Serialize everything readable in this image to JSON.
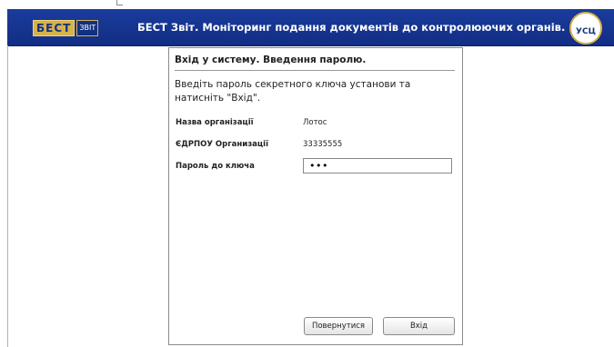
{
  "header": {
    "logo_blocks": [
      "БЕСТ"
    ],
    "logo_zvit": "ЗВІТ",
    "title": "БЕСТ Звіт. Моніторинг подання документів до контролюючих органів.",
    "seal_text": "УСЦ",
    "colors": {
      "header_bg": "#1a3c9c",
      "logo_gold": "#d6b24a"
    }
  },
  "dialog": {
    "title": "Вхід у систему. Введення паролю.",
    "intro": "Введіть пароль секретного ключа установи та натисніть \"Вхід\".",
    "org_name_label": "Назва організації",
    "org_name_value": "Лотос",
    "edrpou_label": "ЄДРПОУ Организації",
    "edrpou_value": "33335555",
    "password_label": "Пароль до ключа",
    "password_value": "•••",
    "back_button": "Повернутися",
    "enter_button": "Вхід"
  }
}
